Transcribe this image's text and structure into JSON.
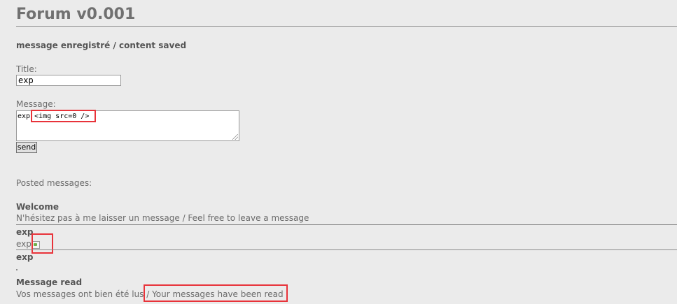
{
  "app": {
    "title": "Forum v0.001",
    "status": "message enregistré / content saved"
  },
  "form": {
    "title_label": "Title:",
    "title_value": "exp",
    "message_label": "Message:",
    "message_value": "exp <img src=0 />",
    "send_label": "send"
  },
  "posts": {
    "section_label": "Posted messages:",
    "items": [
      {
        "title": "Welcome",
        "body": "N'hésitez pas à me laisser un message / Feel free to leave a message"
      },
      {
        "title": "exp",
        "body": "exp"
      },
      {
        "title": "exp",
        "body": ""
      },
      {
        "title": "Message read",
        "body_fr": "Vos messages ont bien été lus / ",
        "body_en": "Your messages have been read"
      }
    ]
  },
  "colors": {
    "highlight": "#e8333a",
    "background": "#ebebeb"
  },
  "icons": {
    "broken_image": "broken-image-icon",
    "resize_grip": "resize-grip-icon"
  }
}
